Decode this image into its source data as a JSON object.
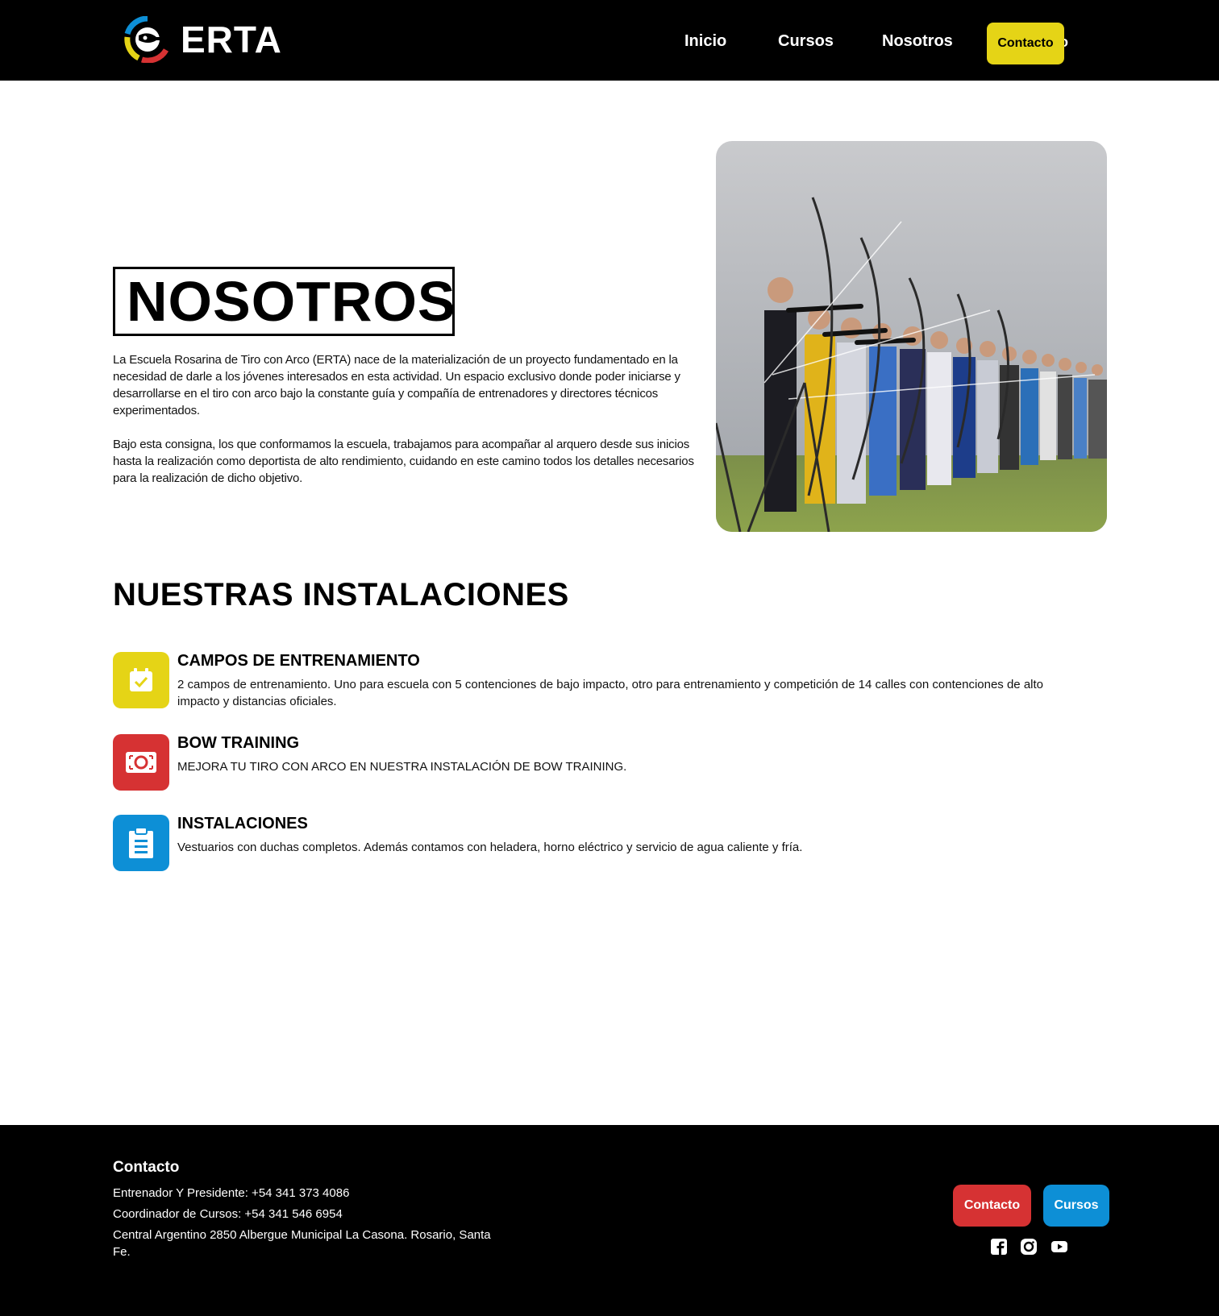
{
  "header": {
    "brand": "ERTA",
    "nav": [
      "Inicio",
      "Cursos",
      "Nosotros"
    ],
    "contact_button": "Contacto",
    "ghost_text": "o"
  },
  "about": {
    "title": "NOSOTROS",
    "paragraphs": [
      "La Escuela Rosarina de Tiro con Arco (ERTA) nace de la materialización de un proyecto fundamentado en la necesidad de darle a los jóvenes interesados en esta actividad. Un espacio exclusivo donde poder iniciarse y desarrollarse en el tiro con arco bajo la constante guía y compañía de entrenadores y directores técnicos experimentados.",
      "Bajo esta consigna, los que conformamos la escuela, trabajamos para acompañar al arquero desde sus inicios hasta la realización como deportista de alto rendimiento, cuidando en este camino todos los detalles necesarios para la realización de dicho objetivo."
    ]
  },
  "facilities": {
    "title": "NUESTRAS INSTALACIONES",
    "items": [
      {
        "name": "CAMPOS DE ENTRENAMIENTO",
        "description": "2 campos de entrenamiento. Uno para escuela con 5 contenciones de bajo impacto, otro para entrenamiento y competición de 14 calles con contenciones de alto impacto y distancias oficiales.",
        "icon": "calendar-check-icon",
        "color": "#e5d416"
      },
      {
        "name": "BOW TRAINING",
        "description": "MEJORA TU TIRO CON ARCO EN NUESTRA INSTALACIÓN DE BOW TRAINING.",
        "icon": "camera-icon",
        "color": "#d63233"
      },
      {
        "name": "INSTALACIONES",
        "description": "Vestuarios con duchas completos. Además contamos con heladera, horno eléctrico y servicio de agua caliente y fría.",
        "icon": "clipboard-icon",
        "color": "#0d8fd6"
      }
    ]
  },
  "footer": {
    "title": "Contacto",
    "lines": [
      "Entrenador Y Presidente: +54 341 373 4086",
      "Coordinador de Cursos: +54 341 546 6954",
      "Central Argentino 2850 Albergue Municipal La Casona. Rosario, Santa Fe."
    ],
    "buttons": [
      {
        "label": "Contacto",
        "color": "#d63233"
      },
      {
        "label": "Cursos",
        "color": "#0d8fd6"
      }
    ],
    "social": [
      "facebook-icon",
      "instagram-icon",
      "youtube-icon"
    ]
  },
  "colors": {
    "accent_yellow": "#e5d416",
    "accent_red": "#d63233",
    "accent_blue": "#0d8fd6",
    "header_bg": "#000000"
  }
}
